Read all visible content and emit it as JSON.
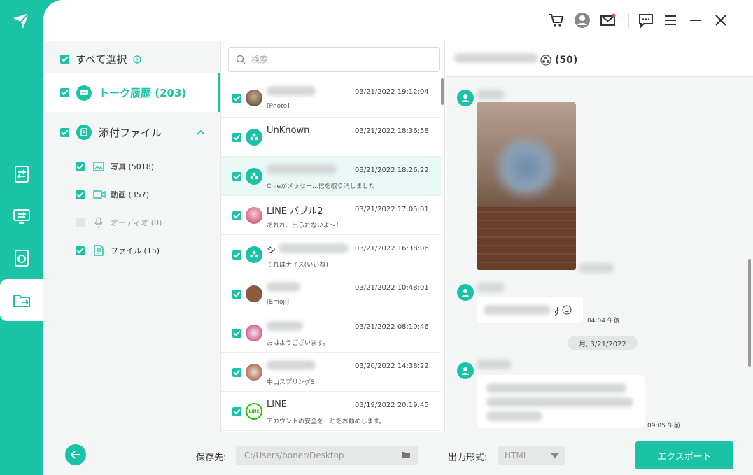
{
  "colors": {
    "accent": "#1bc3a6",
    "selected_row": "#e8f8f4"
  },
  "sidebar": {
    "nav": [
      {
        "icon": "device-transfer-icon"
      },
      {
        "icon": "pc-transfer-icon"
      },
      {
        "icon": "restore-icon"
      },
      {
        "icon": "export-folder-icon",
        "active": true
      }
    ]
  },
  "toolbar": {
    "icons": [
      "cart-icon",
      "account-icon",
      "mail-icon",
      "feedback-icon",
      "menu-icon",
      "minimize-icon",
      "close-icon"
    ]
  },
  "categories": {
    "select_all": "すべて選択",
    "talk_history": "トーク履歴 (203)",
    "attachments": "添付ファイル",
    "sub": [
      {
        "label": "写真 (5018)",
        "checked": true,
        "icon": "photo-icon"
      },
      {
        "label": "動画 (357)",
        "checked": true,
        "icon": "video-icon"
      },
      {
        "label": "オーディオ (0)",
        "checked": false,
        "icon": "microphone-icon"
      },
      {
        "label": "ファイル (15)",
        "checked": true,
        "icon": "file-icon"
      }
    ]
  },
  "search": {
    "placeholder": "検索"
  },
  "conversations": [
    {
      "name": "",
      "time": "03/21/2022 19:12:04",
      "preview": "[Photo]"
    },
    {
      "name": "UnKnown",
      "time": "03/21/2022 18:36:58",
      "preview": ""
    },
    {
      "name": "",
      "time": "03/21/2022 18:26:22",
      "preview": "Chieがメッセー...信を取り消しました"
    },
    {
      "name": "LINE バブル2",
      "time": "03/21/2022 17:05:01",
      "preview": "あれれ、出られないよ～！"
    },
    {
      "name": "シ",
      "time": "03/21/2022 16:38:06",
      "preview": "それはナイス(いいね)"
    },
    {
      "name": "",
      "time": "03/21/2022 10:48:01",
      "preview": "[Emoji]"
    },
    {
      "name": "",
      "time": "03/21/2022 08:10:46",
      "preview": "おはようございます。"
    },
    {
      "name": "",
      "time": "03/20/2022 14:38:22",
      "preview": "中山スプリングS"
    },
    {
      "name": "LINE",
      "time": "03/19/2022 20:19:45",
      "preview": "アカウントの安全を...とをお勧めします。"
    }
  ],
  "chat": {
    "count": "(50)",
    "msg2_suffix": "す",
    "time1": "04:04 午後",
    "date": "月, 3/21/2022",
    "time2": "09:05 午前"
  },
  "footer": {
    "save_label": "保存先:",
    "path": "C:/Users/boner/Desktop",
    "format_label": "出力形式:",
    "format": "HTML",
    "export": "エクスポート"
  }
}
